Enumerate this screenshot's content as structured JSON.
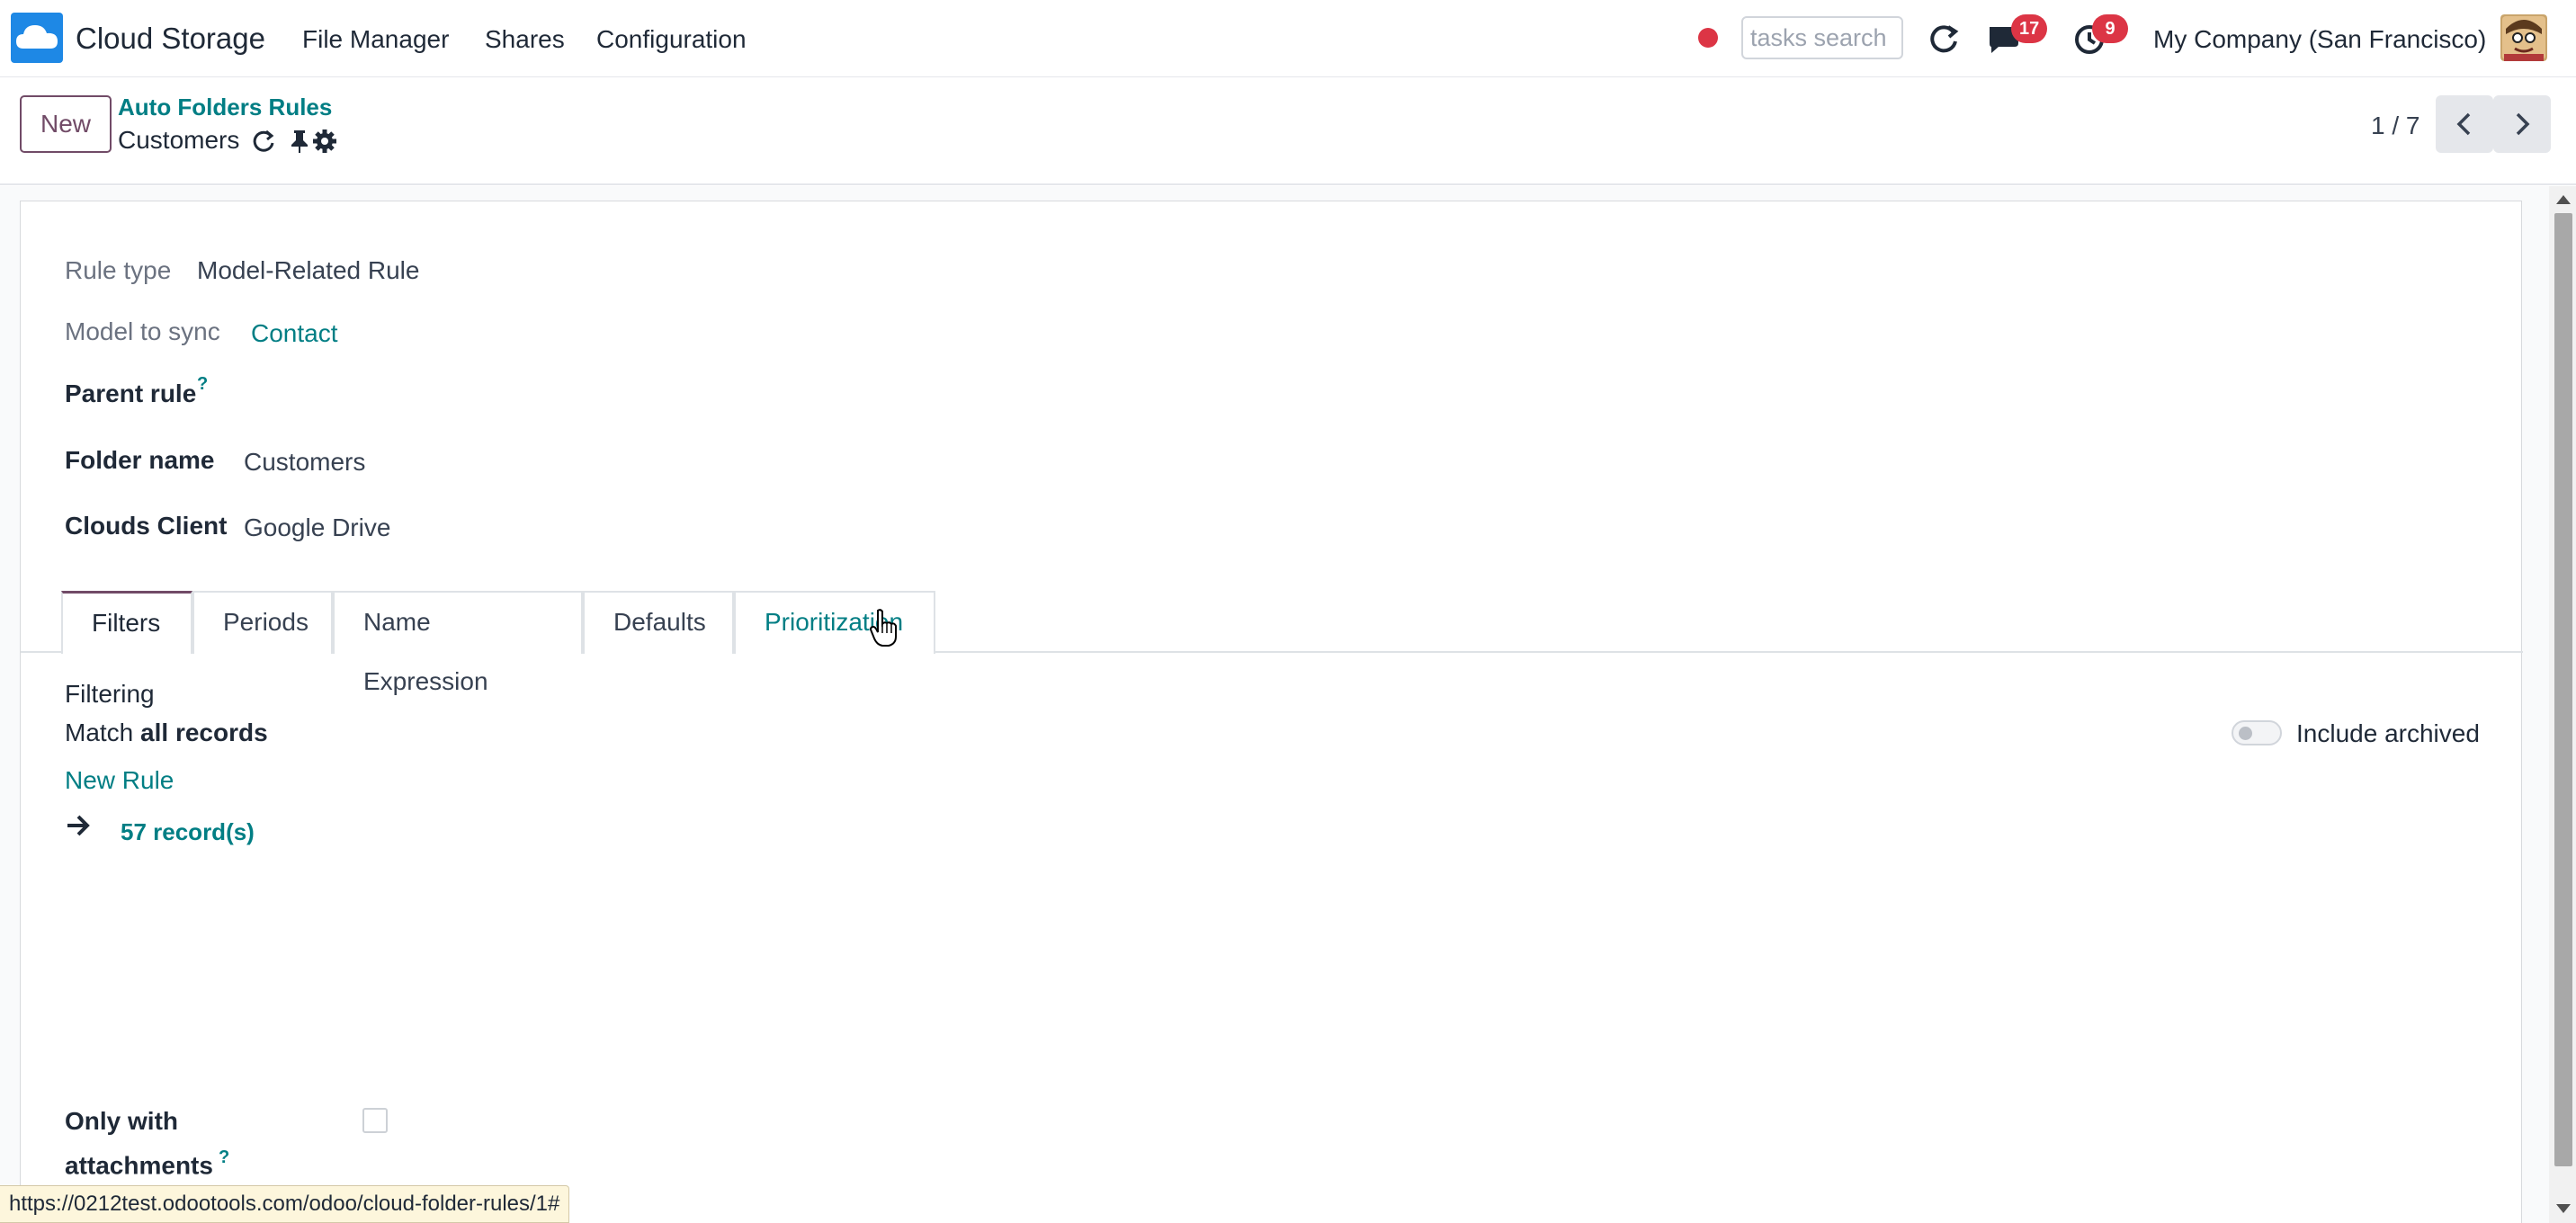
{
  "navbar": {
    "app_name": "Cloud Storage",
    "menu": [
      "File Manager",
      "Shares",
      "Configuration"
    ],
    "search_placeholder": "tasks search",
    "messages_count": "17",
    "activities_count": "9",
    "company": "My Company (San Francisco)"
  },
  "control_panel": {
    "new_label": "New",
    "breadcrumb": "Auto Folders Rules",
    "record_name": "Customers",
    "pager": "1 / 7"
  },
  "form": {
    "rule_type_label": "Rule type",
    "rule_type_value": "Model-Related Rule",
    "model_label": "Model to sync",
    "model_value": "Contact",
    "parent_rule_label": "Parent rule",
    "parent_rule_help": "?",
    "folder_name_label": "Folder name",
    "folder_name_value": "Customers",
    "clouds_client_label": "Clouds Client",
    "clouds_client_value": "Google Drive",
    "tabs": [
      "Filters",
      "Periods",
      "Name Expression",
      "Defaults",
      "Prioritization"
    ],
    "filtering_title": "Filtering",
    "match_prefix": "Match ",
    "match_bold": "all records",
    "new_rule": "New Rule",
    "records": "57 record(s)",
    "include_archived": "Include archived",
    "only_with_attachments": "Only with attachments",
    "only_with_help": "?"
  },
  "status_url": "https://0212test.odootools.com/odoo/cloud-folder-rules/1#",
  "colors": {
    "brand": "#714b67",
    "link": "#017e84",
    "badge": "#dc3545"
  }
}
